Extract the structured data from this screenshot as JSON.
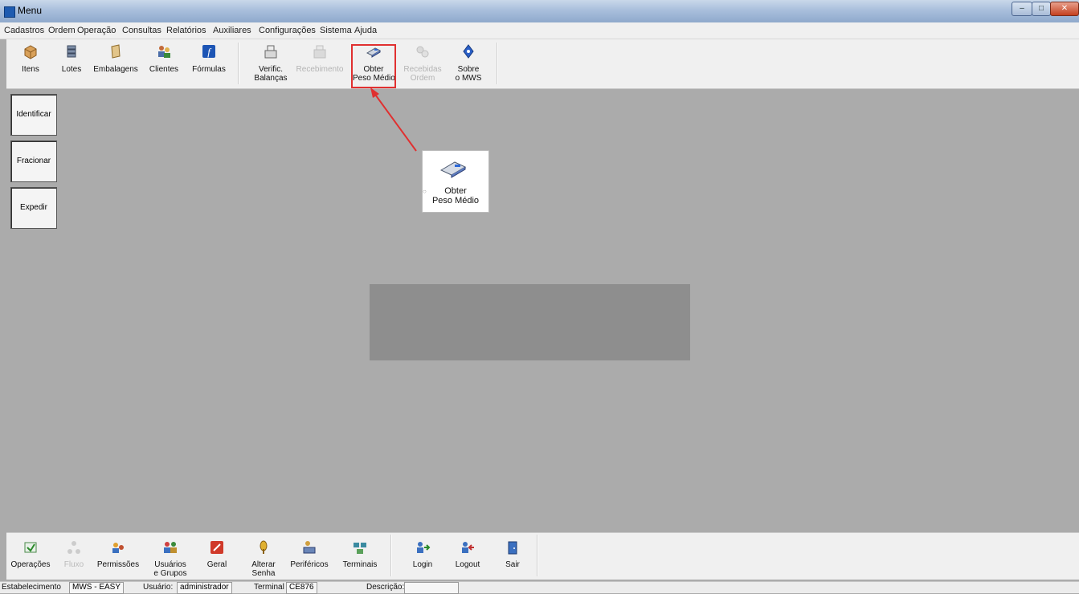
{
  "window": {
    "title": "Menu",
    "min": "–",
    "max": "□",
    "close": "✕"
  },
  "menu": [
    "Cadastros",
    "Ordem",
    "Operação",
    "Consultas",
    "Relatórios",
    "Auxiliares",
    "Configurações",
    "Sistema",
    "Ajuda"
  ],
  "toolbar": {
    "itens": "Itens",
    "lotes": "Lotes",
    "embalagens": "Embalagens",
    "clientes": "Clientes",
    "formulas": "Fórmulas",
    "verific_l1": "Verific.",
    "verific_l2": "Balanças",
    "recebimento": "Recebimento",
    "obter_l1": "Obter",
    "obter_l2": "Peso Médio",
    "recebido_l1": "Recebidas",
    "recebido_l2": "Ordem",
    "sobre_l1": "Sobre",
    "sobre_l2": "o MWS"
  },
  "side": {
    "identificar": "Identificar",
    "fracionar": "Fracionar",
    "expedir": "Expedir"
  },
  "popup": {
    "line1": "Obter",
    "line2": "Peso Médio"
  },
  "bottom": {
    "operacoes": "Operações",
    "fluxo": "Fluxo",
    "permissoes": "Permissões",
    "usuarios_l1": "Usuários",
    "usuarios_l2": "e Grupos",
    "geral": "Geral",
    "alterar_l1": "Alterar",
    "alterar_l2": "Senha",
    "perifericos": "Periféricos",
    "terminais": "Terminais",
    "login": "Login",
    "logout": "Logout",
    "sair": "Sair"
  },
  "status": {
    "estab_label": "Estabelecimento",
    "estab_value": "MWS - EASY",
    "user_label": "Usuário:",
    "user_value": "administrador",
    "term_label": "Terminal",
    "term_value": "CE876",
    "desc_label": "Descrição:"
  },
  "colors": {
    "highlight": "#e03030",
    "workspace": "#ababab"
  }
}
